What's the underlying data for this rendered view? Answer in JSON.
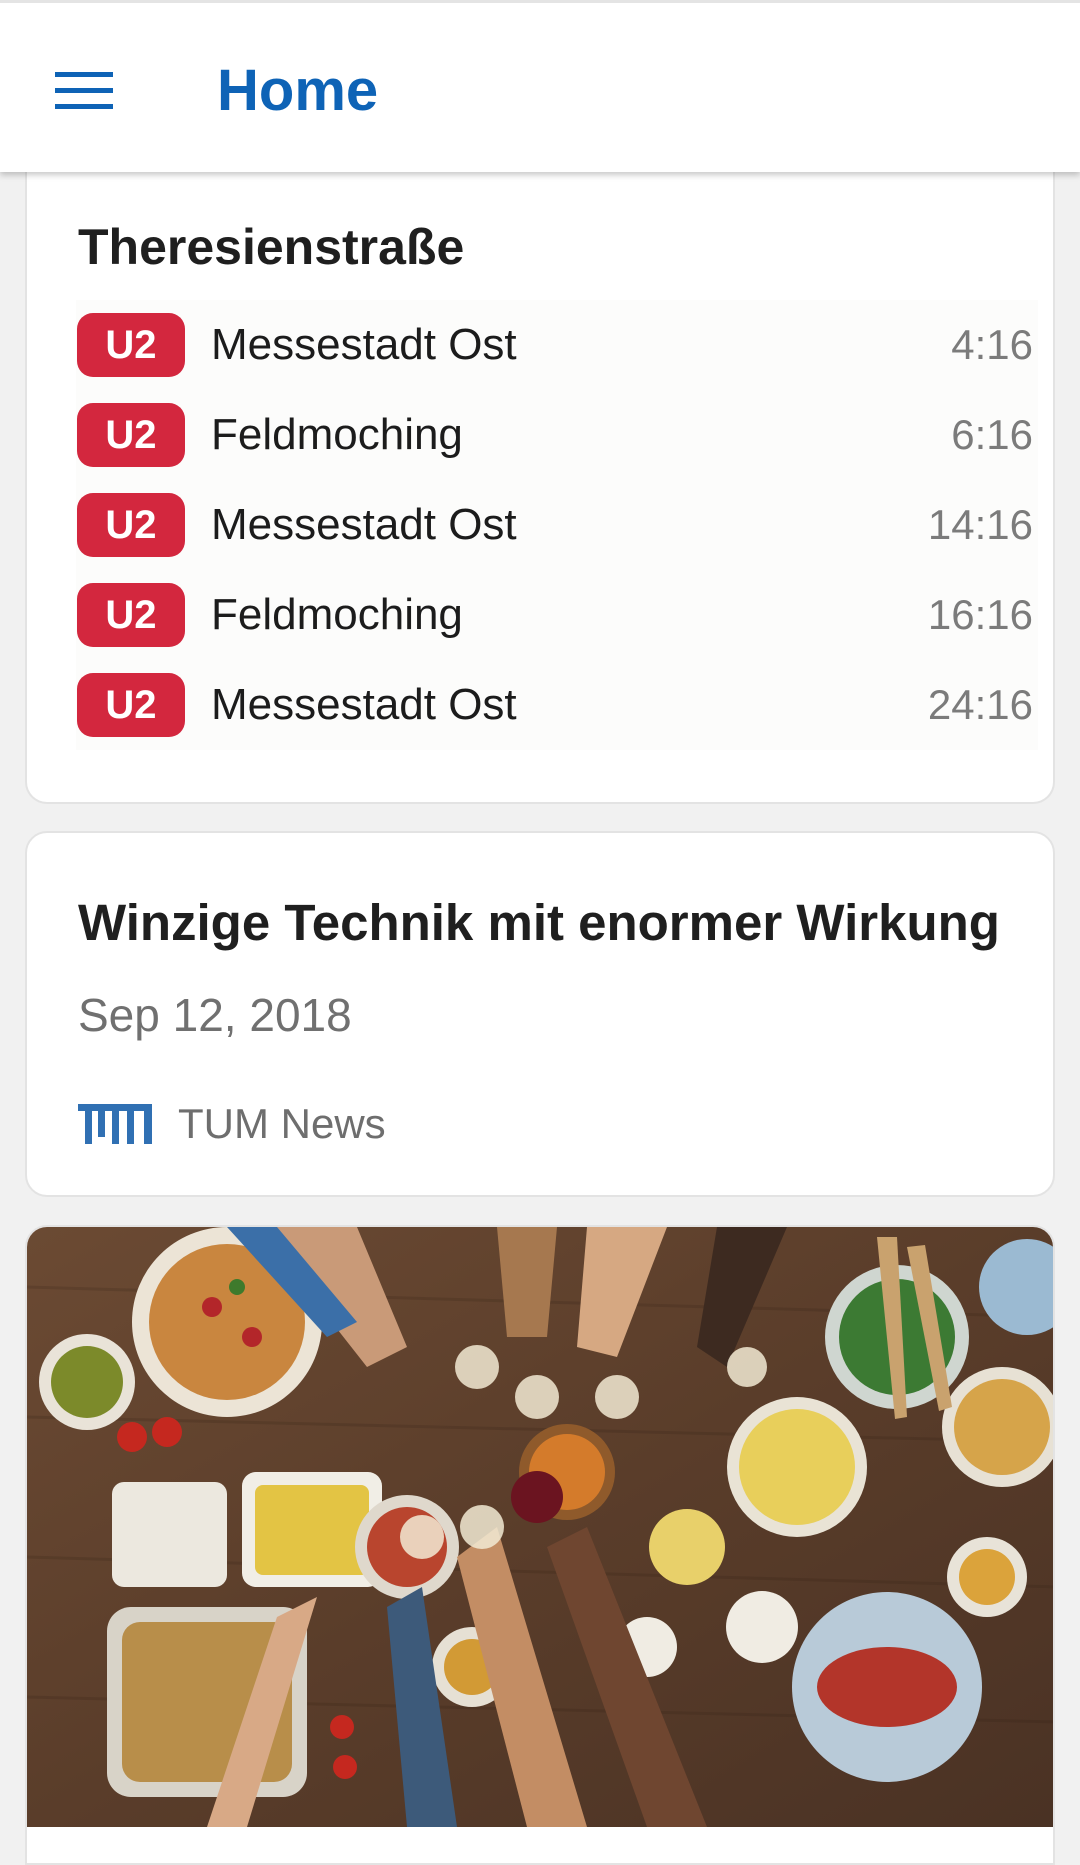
{
  "appbar": {
    "title": "Home",
    "menu_icon": "hamburger-menu-icon",
    "title_color": "#0e63b6"
  },
  "transport": {
    "station": "Theresienstraße",
    "badge_color": "#d3273e",
    "departures": [
      {
        "line": "U2",
        "destination": "Messestadt Ost",
        "time": "4:16"
      },
      {
        "line": "U2",
        "destination": "Feldmoching",
        "time": "6:16"
      },
      {
        "line": "U2",
        "destination": "Messestadt Ost",
        "time": "14:16"
      },
      {
        "line": "U2",
        "destination": "Feldmoching",
        "time": "16:16"
      },
      {
        "line": "U2",
        "destination": "Messestadt Ost",
        "time": "24:16"
      }
    ]
  },
  "news": {
    "title": "Winzige Technik mit enormer Wirkung",
    "date": "Sep 12, 2018",
    "source": "TUM News",
    "source_icon": "tum-logo-icon"
  },
  "image_card": {
    "image": "food-table-photo"
  }
}
